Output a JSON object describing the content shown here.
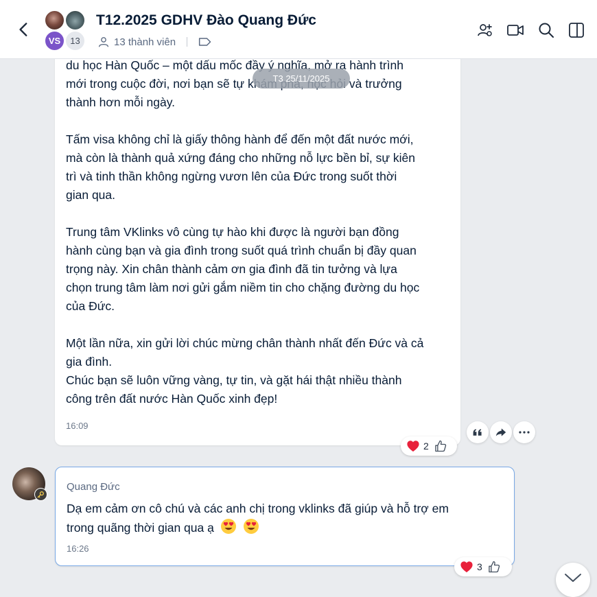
{
  "header": {
    "title": "T12.2025 GDHV Đào Quang Đức",
    "avatar_initials": "VS",
    "avatar_count": "13",
    "member_count": "13 thành viên"
  },
  "date_divider": "T3 25/11/2025",
  "message1": {
    "paragraphs": [
      [
        "du học Hàn Quốc – một dấu mốc đầy ý nghĩa, mở ra hành trình",
        "mới trong cuộc đời, nơi bạn sẽ tự khám phá, học hỏi và trưởng",
        "thành hơn mỗi ngày."
      ],
      [
        "Tấm visa không chỉ là giấy thông hành để đến một đất nước mới,",
        "mà còn là thành quả xứng đáng cho những nỗ lực bền bỉ, sự kiên",
        "trì và tinh thần không ngừng vươn lên của Đức trong suốt thời",
        "gian qua."
      ],
      [
        "Trung tâm VKlinks vô cùng tự hào khi được là người bạn đồng",
        "hành cùng bạn và gia đình trong suốt quá trình chuẩn bị đầy quan",
        "trọng này. Xin chân thành cảm ơn gia đình đã tin tưởng và lựa",
        "chọn trung tâm làm nơi gửi gắm niềm tin cho chặng đường du học",
        "của Đức."
      ],
      [
        "Một lần nữa, xin gửi lời chúc mừng chân thành nhất đến Đức và cả",
        "gia đình.",
        "Chúc bạn sẽ luôn vững vàng, tự tin, và gặt hái thật nhiều thành",
        "công trên đất nước Hàn Quốc xinh đẹp!"
      ]
    ],
    "time": "16:09",
    "reaction_count": "2"
  },
  "message2": {
    "sender": "Quang Đức",
    "lines": [
      "Dạ em cảm ơn cô chú và các anh chị trong vklinks đã giúp và hỗ trợ em",
      "trong quãng thời gian qua ạ"
    ],
    "time": "16:26",
    "reaction_count": "3"
  },
  "colors": {
    "accent": "#005ae0",
    "reply_border": "#78a8e6",
    "heart": "#e8213b",
    "background": "#eaecef"
  },
  "icons": [
    "back-icon",
    "add-member-icon",
    "video-call-icon",
    "search-icon",
    "sidebar-toggle-icon",
    "person-icon",
    "tag-icon",
    "quote-icon",
    "share-icon",
    "more-icon",
    "heart-icon",
    "thumbs-up-icon",
    "key-icon",
    "heart-eyes-emoji",
    "chevron-down-icon"
  ]
}
